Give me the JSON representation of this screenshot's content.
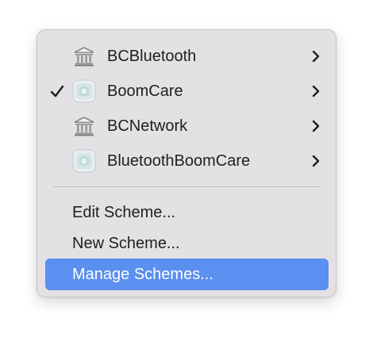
{
  "menu": {
    "scheme_items": [
      {
        "label": "BCBluetooth",
        "icon": "bank-icon",
        "checked": false
      },
      {
        "label": "BoomCare",
        "icon": "app-icon",
        "checked": true
      },
      {
        "label": "BCNetwork",
        "icon": "bank-icon",
        "checked": false
      },
      {
        "label": "BluetoothBoomCare",
        "icon": "app-icon",
        "checked": false
      }
    ],
    "actions": [
      {
        "label": "Edit Scheme..."
      },
      {
        "label": "New Scheme..."
      },
      {
        "label": "Manage Schemes...",
        "highlighted": true
      }
    ],
    "colors": {
      "menu_bg": "#e3e1e4",
      "highlight": "#5b8ff0",
      "text": "#1f1f1f"
    }
  }
}
